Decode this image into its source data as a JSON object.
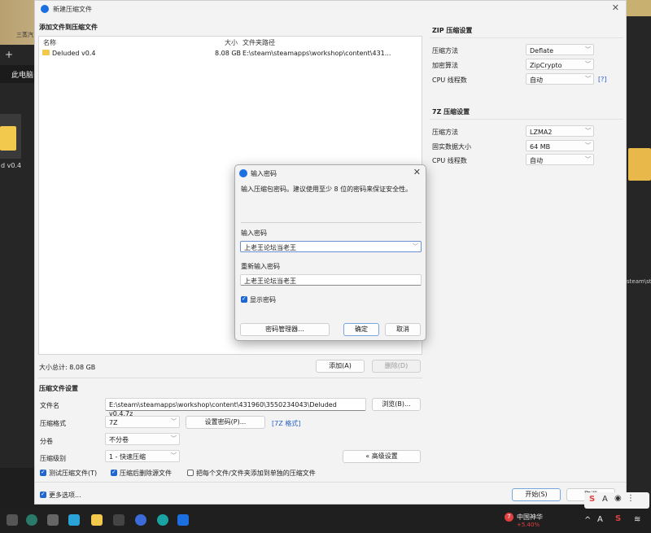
{
  "background": {
    "explorer_tab": "此电脑",
    "explorer_folder_label": "d v0.4",
    "right_path_fragment": "steam\\st",
    "top_left_text": "三蒸汽"
  },
  "main_window": {
    "title": "新建压缩文件",
    "add_files_heading": "添加文件到压缩文件",
    "list_headers": {
      "name": "名称",
      "size": "大小",
      "path": "文件夹路径"
    },
    "files": [
      {
        "name": "Deluded v0.4",
        "size": "8.08 GB",
        "path": "E:\\steam\\steamapps\\workshop\\content\\431..."
      }
    ],
    "total_size": "大小总计: 8.08 GB",
    "add_button": "添加(A)",
    "delete_button": "删除(D)",
    "settings_heading": "压缩文件设置",
    "filename_label": "文件名",
    "filename_value": "E:\\steam\\steamapps\\workshop\\content\\431960\\3550234043\\Deluded v0.4.7z",
    "browse_button": "浏览(B)...",
    "format_label": "压缩格式",
    "format_value": "7Z",
    "set_password_button": "设置密码(P)...",
    "format_link": "[7Z 格式]",
    "volume_label": "分卷",
    "volume_value": "不分卷",
    "level_label": "压缩级别",
    "level_value": "1 - 快速压缩",
    "advanced_button": "« 高级设置",
    "checks": [
      {
        "label": "测试压缩文件(T)",
        "checked": true
      },
      {
        "label": "压缩后删除源文件",
        "checked": true
      },
      {
        "label": "把每个文件/文件夹添加到单独的压缩文件",
        "checked": false
      }
    ],
    "more_options": "更多选项...",
    "start_button": "开始(S)",
    "cancel_button": "取消"
  },
  "zip_settings": {
    "heading": "ZIP 压缩设置",
    "rows": [
      {
        "label": "压缩方法",
        "value": "Deflate"
      },
      {
        "label": "加密算法",
        "value": "ZipCrypto"
      },
      {
        "label": "CPU 线程数",
        "value": "自动"
      }
    ],
    "help_link": "[?]"
  },
  "sevenz_settings": {
    "heading": "7Z 压缩设置",
    "rows": [
      {
        "label": "压缩方法",
        "value": "LZMA2"
      },
      {
        "label": "固实数据大小",
        "value": "64 MB"
      },
      {
        "label": "CPU 线程数",
        "value": "自动"
      }
    ]
  },
  "password_dialog": {
    "title": "输入密码",
    "hint": "输入压缩包密码。建议使用至少 8 位的密码来保证安全性。",
    "password_label": "输入密码",
    "password_value": "上老王论坛当老王",
    "confirm_label": "重新输入密码",
    "confirm_value": "上老王论坛当老王",
    "show_password": "显示密码",
    "manager_button": "密码管理器...",
    "ok_button": "确定",
    "cancel_button": "取消"
  },
  "taskbar": {
    "stock_name": "中国神华",
    "stock_change": "+5.40%",
    "stock_badge": "7",
    "tray_letter": "A"
  },
  "colors": {
    "accent": "#1e66d0",
    "link": "#2360c8",
    "stock_up": "#e04040"
  }
}
